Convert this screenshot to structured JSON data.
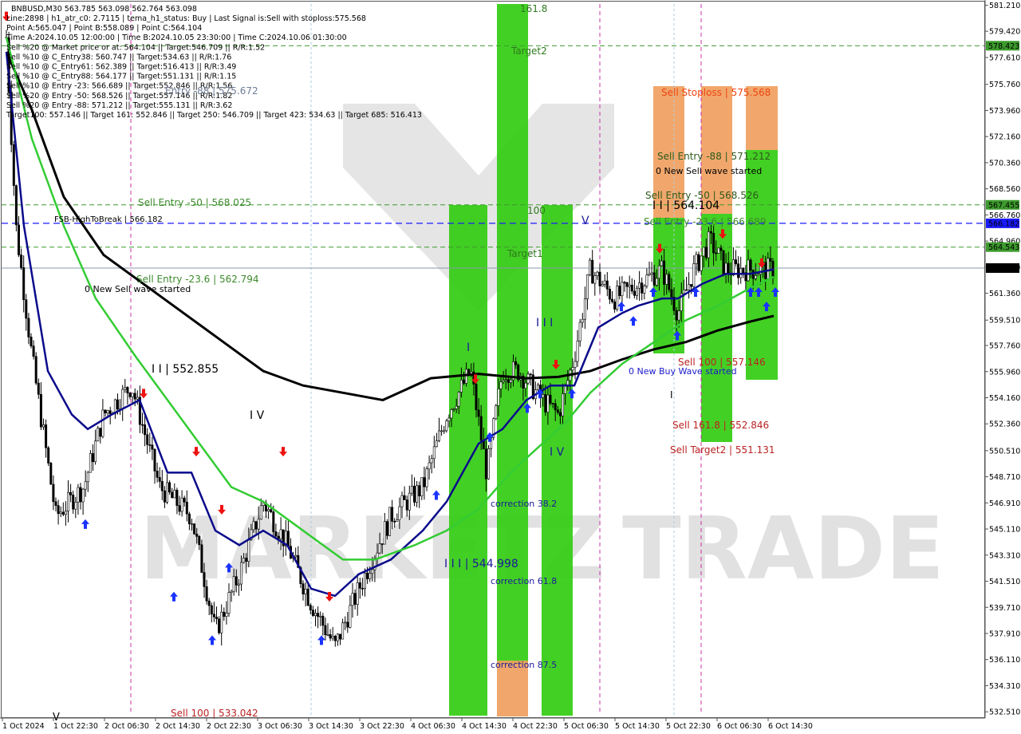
{
  "chart_data": {
    "type": "candlestick",
    "symbol_line": "BNBUSD,M30  563.785 563.098 562.764 563.098",
    "info_lines": [
      "Line:2898 | h1_atr_c0: 2.7115 | tema_h1_status: Buy | Last Signal is:Sell with stoploss:575.568",
      "Point A:565.047 | Point B:558.089 | Point C:564.104",
      "Time A:2024.10.05 12:00:00 | Time B:2024.10.05 23:30:00 | Time C:2024.10.06 01:30:00",
      "Sell %20 @ Market price or at: 564.104 || Target:546.709 || R/R:1.52",
      "Sell %10 @ C_Entry38: 560.747 || Target:534.63 || R/R:1.76",
      "Sell %10 @ C_Entry61: 562.389 || Target:516.413 || R/R:3.49",
      "Sell %10 @ C_Entry88: 564.177 || Target:551.131 || R/R:1.15",
      "Sell %10 @ Entry -23: 566.689 || Target:552.846 || R/R:1.56",
      "Sell %20 @ Entry -50: 568.526 || Target:557.146 || R/R:1.82",
      "Sell %20 @ Entry -88: 571.212 || Target:555.131 || R/R:3.62",
      "Target100: 557.146 || Target 161: 552.846 || Target 250: 546.709 || Target 423: 534.63 || Target 685: 516.413"
    ],
    "y_ticks": [
      "581.210",
      "579.420",
      "577.610",
      "575.760",
      "573.960",
      "572.160",
      "570.360",
      "568.560",
      "566.760",
      "564.960",
      "563.160",
      "561.360",
      "559.510",
      "557.760",
      "555.960",
      "554.160",
      "552.360",
      "550.510",
      "548.710",
      "546.910",
      "545.110",
      "543.310",
      "541.510",
      "539.710",
      "537.910",
      "536.110",
      "534.310",
      "532.510"
    ],
    "x_ticks": [
      "1 Oct 2024",
      "1 Oct 22:30",
      "2 Oct 06:30",
      "2 Oct 14:30",
      "2 Oct 22:30",
      "3 Oct 06:30",
      "3 Oct 14:30",
      "3 Oct 22:30",
      "4 Oct 06:30",
      "4 Oct 14:30",
      "4 Oct 22:30",
      "5 Oct 06:30",
      "5 Oct 14:30",
      "5 Oct 22:30",
      "6 Oct 06:30",
      "6 Oct 14:30"
    ],
    "ylim": [
      532.3,
      581.3
    ],
    "price_badges": [
      {
        "value": 578.423,
        "label": "578.423",
        "color": "#3c9a2c"
      },
      {
        "value": 567.455,
        "label": "567.455",
        "color": "#3c9a2c"
      },
      {
        "value": 566.182,
        "label": "566.182",
        "color": "#1a1aff"
      },
      {
        "value": 564.543,
        "label": "564.543",
        "color": "#3c9a2c"
      },
      {
        "value": 563.098,
        "label": "563.098",
        "color": "#000000"
      }
    ],
    "labels": {
      "fsb": "FSB-HighToBreak | 566.182",
      "sell_entry_50_left": "Sell Entry -50 | 568.025",
      "sell_entry_23_left": "Sell Entry -23.6 | 562.794",
      "new_sell_wave_left": "0 New Sell wave started",
      "entry_575": "Entry -88 | 575.672",
      "wave_552": "I I | 552.855",
      "wave_iv_left": "I V",
      "sell100_left": "Sell 100 | 533.042",
      "lvl_161": "161.8",
      "target2": "Target2",
      "lvl_100": "100",
      "target1": "Target1",
      "wave_i": "I",
      "wave_iii": "I I I",
      "wave_iv": "I V",
      "wave_v": "V",
      "wave_iii_544": "I I I | 544.998",
      "corr_382": "correction 38.2",
      "corr_618": "correction 61.8",
      "corr_875": "correction 87.5",
      "sell_stoploss": "Sell Stoploss | 575.568",
      "sell_entry_88": "Sell Entry -88 | 571.212",
      "new_sell_wave_right": "0 New Sell wave started",
      "sell_entry_50": "Sell Entry -50 | 568.526",
      "wave_564": "I I | 564.104",
      "sell_entry_23": "Sell Entry -23.6 | 566.689",
      "sell_100": "Sell 100 | 557.146",
      "new_buy_wave": "0 New Buy Wave started",
      "wave_i_right": "I",
      "sell_1618": "Sell 161.8 | 552.846",
      "sell_target2": "Sell Target2 | 551.131",
      "watermark_left": "MARKETZ",
      "watermark_right": "TRADE",
      "wave_v_bottom": "V"
    },
    "colors": {
      "green_zone": "#33cc11",
      "orange_zone": "#f0a060",
      "sma_black": "#000000",
      "tema_blue": "#0a0a8c",
      "ma_green": "#33cc33",
      "buy_arrow": "#1a33ff",
      "sell_arrow": "#ee1111"
    }
  }
}
